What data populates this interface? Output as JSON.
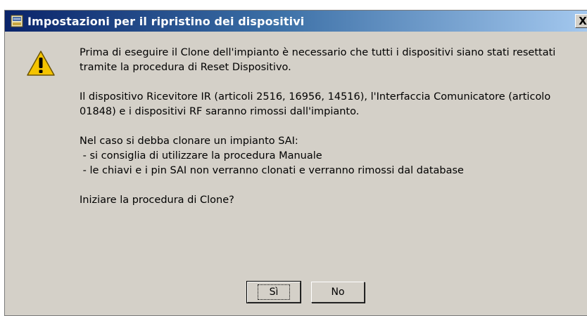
{
  "dialog": {
    "title": "Impostazioni per il ripristino dei dispositivi",
    "close_label": "X",
    "icons": {
      "title": "app-icon",
      "warning": "warning-icon",
      "close": "close-icon"
    },
    "message": {
      "p1": [
        "Prima di eseguire il Clone dell'impianto è necessario che tutti i dispositivi siano stati resettati",
        "tramite la procedura di Reset Dispositivo."
      ],
      "p2": [
        "Il dispositivo Ricevitore IR (articoli 2516, 16956, 14516), l'Interfaccia Comunicatore (articolo",
        "01848) e i dispositivi RF saranno rimossi dall'impianto."
      ],
      "p3": [
        "Nel caso si debba clonare un impianto SAI:",
        " - si consiglia di utilizzare la procedura Manuale",
        " - le chiavi e i pin SAI non verranno clonati e verranno rimossi dal database"
      ],
      "p4": [
        "Iniziare la procedura di Clone?"
      ]
    },
    "buttons": {
      "yes": "Sì",
      "no": "No"
    },
    "colors": {
      "titlebar_start": "#0a246a",
      "titlebar_end": "#a6caf0",
      "face": "#d4d0c8",
      "warning": "#f5c400"
    }
  }
}
